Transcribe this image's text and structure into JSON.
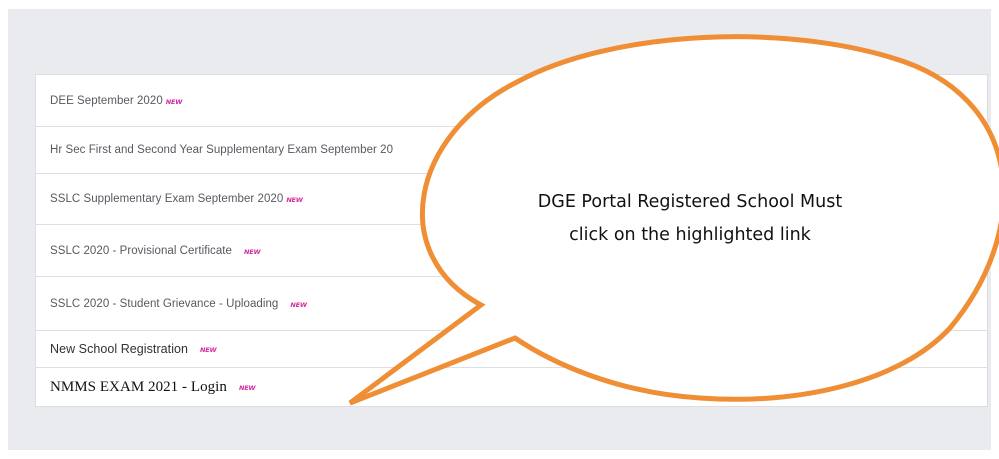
{
  "links": [
    {
      "label": "DEE September 2020",
      "badge": "NEW"
    },
    {
      "label": "Hr Sec First and Second Year Supplementary Exam September 20",
      "badge": ""
    },
    {
      "label": "SSLC Supplementary Exam September 2020",
      "badge": "NEW"
    },
    {
      "label": "SSLC 2020 - Provisional Certificate",
      "badge": "NEW"
    },
    {
      "label": "SSLC 2020 - Student Grievance - Uploading",
      "badge": "NEW"
    },
    {
      "label": "New School Registration",
      "badge": "NEW"
    },
    {
      "label": "NMMS EXAM 2021 - Login",
      "badge": "NEW"
    }
  ],
  "callout": {
    "line1": "DGE Portal Registered School Must",
    "line2": "click on the highlighted link"
  },
  "colors": {
    "callout_border": "#ef8e35",
    "new_badge": "#d42ba0",
    "panel_background": "#e9ebee"
  }
}
